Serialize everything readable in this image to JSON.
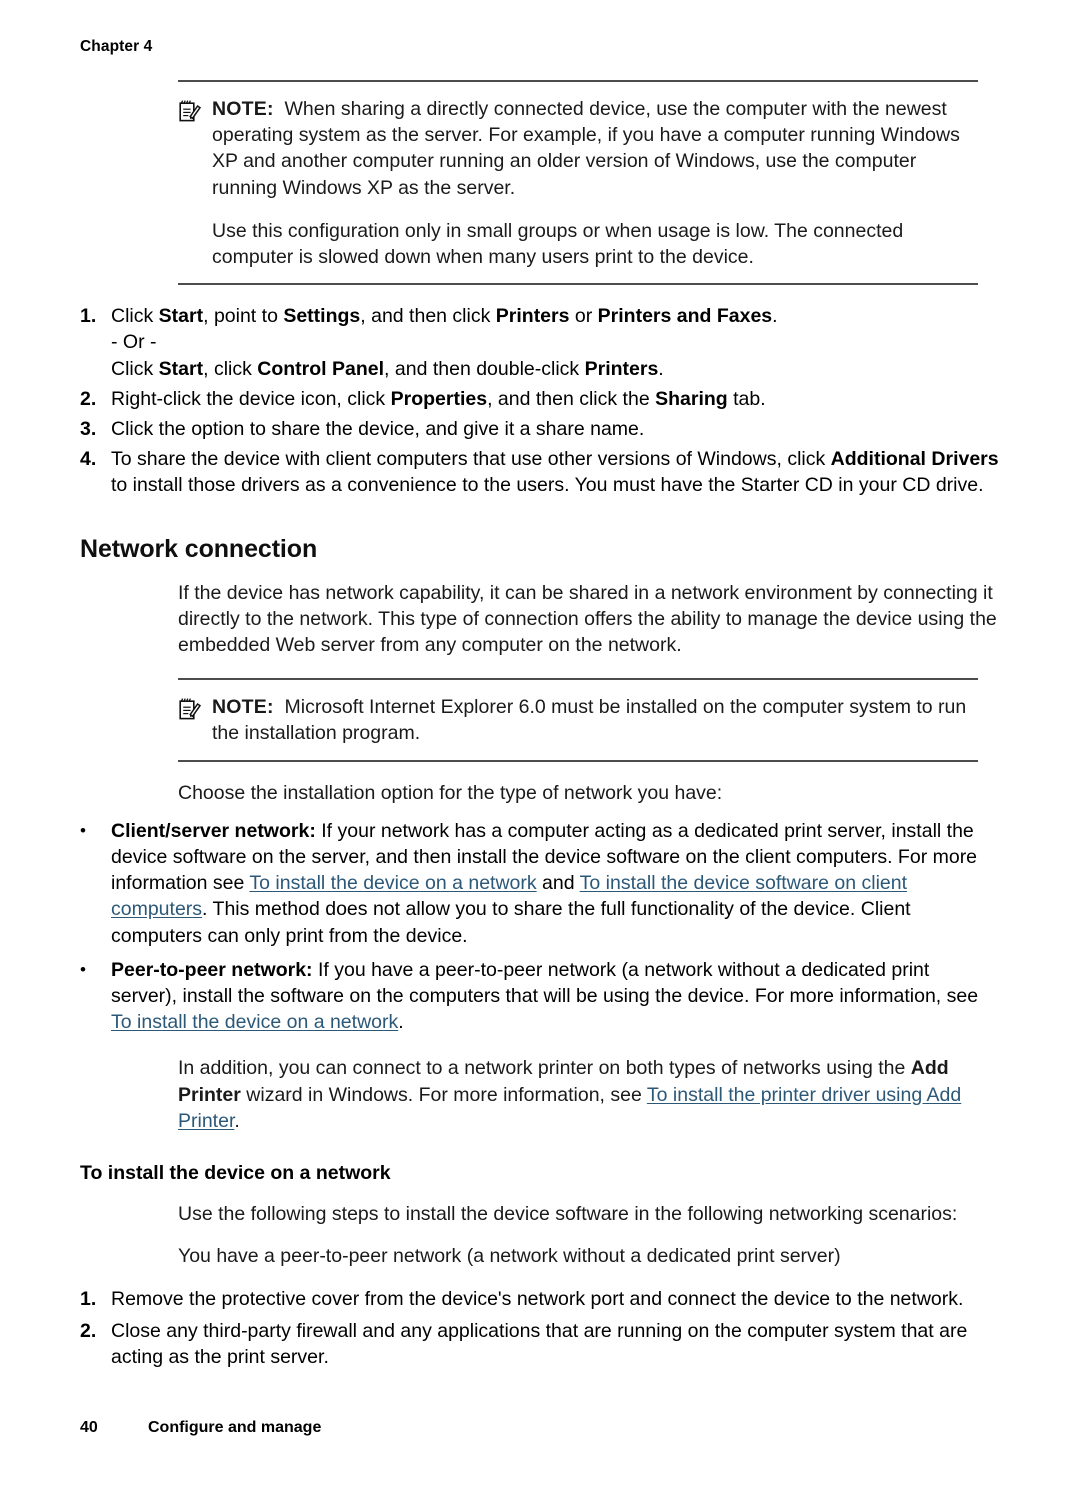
{
  "document": {
    "running_head": "Chapter 4",
    "footer": {
      "page_number": "40",
      "page_title": "Configure and manage"
    }
  },
  "note1": {
    "icon": "note-pad-pencil-icon",
    "label": "NOTE:",
    "text": "When sharing a directly connected device, use the computer with the newest operating system as the server. For example, if you have a computer running Windows XP and another computer running an older version of Windows, use the computer running Windows XP as the server.",
    "paragraph2": "Use this configuration only in small groups or when usage is low. The connected computer is slowed down when many users print to the device."
  },
  "sharing_steps": [
    {
      "num": "1.",
      "part1_a": "Click ",
      "part1_b": "Start",
      "part1_c": ", point to ",
      "part1_d": "Settings",
      "part1_e": ", and then click ",
      "part1_f": "Printers",
      "part1_g": " or ",
      "part1_h": "Printers and Faxes",
      "part1_i": ".",
      "or_line": "- Or -",
      "part2_a": "Click ",
      "part2_b": "Start",
      "part2_c": ", click ",
      "part2_d": "Control Panel",
      "part2_e": ", and then double-click ",
      "part2_f": "Printers",
      "part2_g": "."
    },
    {
      "num": "2.",
      "a": "Right-click the device icon, click ",
      "b": "Properties",
      "c": ", and then click the ",
      "d": "Sharing",
      "e": " tab."
    },
    {
      "num": "3.",
      "a": "Click the option to share the device, and give it a share name."
    },
    {
      "num": "4.",
      "a": "To share the device with client computers that use other versions of Windows, click ",
      "b": "Additional Drivers",
      "c": " to install those drivers as a convenience to the users. You must have the Starter CD in your CD drive."
    }
  ],
  "network_section": {
    "title": "Network connection",
    "intro": "If the device has network capability, it can be shared in a network environment by connecting it directly to the network. This type of connection offers the ability to manage the device using the embedded Web server from any computer on the network.",
    "note": {
      "icon": "note-pad-pencil-icon",
      "label": "NOTE:",
      "text": "Microsoft Internet Explorer 6.0 must be installed on the computer system to run the installation program."
    },
    "choose_line": "Choose the installation option for the type of network you have:",
    "bullets": [
      {
        "marker": "•",
        "lead": "Client/server network:",
        "a": " If your network has a computer acting as a dedicated print server, install the device software on the server, and then install the device software on the client computers. For more information see ",
        "link1": "To install the device on a network",
        "b": " and ",
        "link2": "To install the device software on client computers",
        "c": ". This method does not allow you to share the full functionality of the device. Client computers can only print from the device."
      },
      {
        "marker": "•",
        "lead": "Peer-to-peer network:",
        "a": " If you have a peer-to-peer network (a network without a dedicated print server), install the software on the computers that will be using the device. For more information, see ",
        "link1": "To install the device on a network",
        "c": "."
      }
    ],
    "addition_para": {
      "a": "In addition, you can connect to a network printer on both types of networks using the ",
      "b": "Add Printer",
      "c": " wizard in Windows. For more information, see ",
      "link": "To install the printer driver using Add Printer",
      "d": "."
    },
    "subsection": {
      "title": "To install the device on a network",
      "intro": "Use the following steps to install the device software in the following networking scenarios:",
      "scenario": "You have a peer-to-peer network (a network without a dedicated print server)",
      "steps": [
        {
          "num": "1.",
          "text": "Remove the protective cover from the device's network port and connect the device to the network."
        },
        {
          "num": "2.",
          "text": "Close any third-party firewall and any applications that are running on the computer system that are acting as the print server."
        }
      ]
    }
  },
  "colors": {
    "link": "#2c5878",
    "rule": "#4d4d4d",
    "text": "#1a1a1a"
  }
}
